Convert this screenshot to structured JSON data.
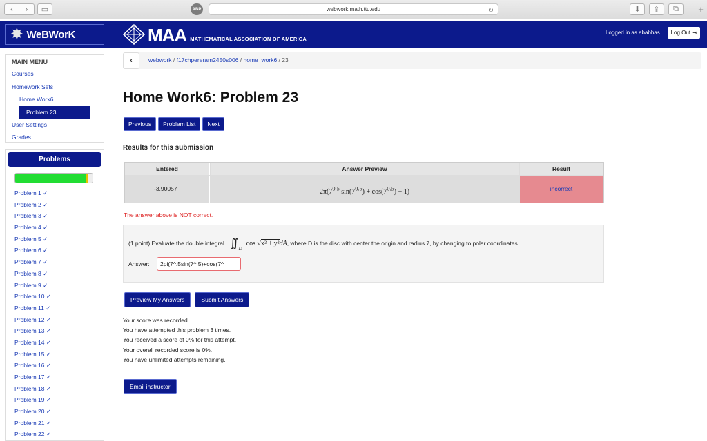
{
  "browser": {
    "url": "webwork.math.ttu.edu",
    "adblock": "ABP"
  },
  "header": {
    "logo": "WeBWorK",
    "maa": "MAA",
    "maa_sub": "MATHEMATICAL ASSOCIATION OF AMERICA",
    "logged_in": "Logged in as ababbas.",
    "logout": "Log Out"
  },
  "menu": {
    "title": "MAIN MENU",
    "courses": "Courses",
    "homework_sets": "Homework Sets",
    "home_work6": "Home Work6",
    "problem23": "Problem 23",
    "user_settings": "User Settings",
    "grades": "Grades"
  },
  "problems": {
    "button": "Problems",
    "progress": 0.95,
    "items": [
      "Problem 1 ✓",
      "Problem 2 ✓",
      "Problem 3 ✓",
      "Problem 4 ✓",
      "Problem 5 ✓",
      "Problem 6 ✓",
      "Problem 7 ✓",
      "Problem 8 ✓",
      "Problem 9 ✓",
      "Problem 10 ✓",
      "Problem 11 ✓",
      "Problem 12 ✓",
      "Problem 13 ✓",
      "Problem 14 ✓",
      "Problem 15 ✓",
      "Problem 16 ✓",
      "Problem 17 ✓",
      "Problem 18 ✓",
      "Problem 19 ✓",
      "Problem 20 ✓",
      "Problem 21 ✓",
      "Problem 22 ✓"
    ]
  },
  "breadcrumb": {
    "webwork": "webwork",
    "course": "f17chpereram2450s006",
    "set": "home_work6",
    "problem": "23"
  },
  "main": {
    "title": "Home Work6: Problem 23",
    "previous": "Previous",
    "problem_list": "Problem List",
    "next": "Next",
    "results_heading": "Results for this submission",
    "col_entered": "Entered",
    "col_preview": "Answer Preview",
    "col_result": "Result",
    "entered": "-3.90057",
    "result": "incorrect",
    "not_correct": "The answer above is NOT correct.",
    "question_prefix": "(1 point) Evaluate the double integral",
    "question_suffix": ", where D is the disc with center the origin and radius 7, by changing to polar coordinates.",
    "answer_label": "Answer:",
    "answer_value": "2pi(7^.5sin(7^.5)+cos(7^",
    "preview_btn": "Preview My Answers",
    "submit_btn": "Submit Answers",
    "score_lines": [
      "Your score was recorded.",
      "You have attempted this problem 3 times.",
      "You received a score of 0% for this attempt.",
      "Your overall recorded score is 0%.",
      "You have unlimited attempts remaining."
    ],
    "email_btn": "Email instructor"
  },
  "colors": {
    "brand_navy": "#0c1a8c",
    "link_blue": "#1a3bb5",
    "incorrect_bg": "#e68a90",
    "error_red": "#d22"
  }
}
